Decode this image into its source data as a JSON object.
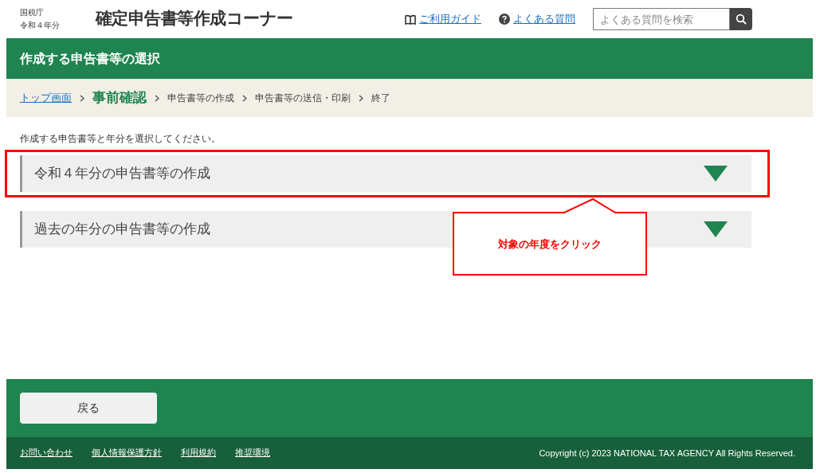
{
  "header": {
    "agency": "国税庁",
    "year": "令和４年分",
    "title": "確定申告書等作成コーナー",
    "links": [
      {
        "kind": "guide",
        "label": "ご利用ガイド"
      },
      {
        "kind": "faq",
        "label": "よくある質問"
      }
    ],
    "search": {
      "placeholder": "よくある質問を検索"
    }
  },
  "page_title": "作成する申告書等の選択",
  "breadcrumb": [
    {
      "label": "トップ画面",
      "kind": "link",
      "current": false
    },
    {
      "label": "事前確認",
      "kind": "step",
      "current": true
    },
    {
      "label": "申告書等の作成",
      "kind": "step",
      "current": false
    },
    {
      "label": "申告書等の送信・印刷",
      "kind": "step",
      "current": false
    },
    {
      "label": "終了",
      "kind": "step",
      "current": false
    }
  ],
  "instruction": "作成する申告書等と年分を選択してください。",
  "sections": [
    {
      "label": "令和４年分の申告書等の作成",
      "expanded": false,
      "highlighted": true
    },
    {
      "label": "過去の年分の申告書等の作成",
      "expanded": false,
      "highlighted": false
    }
  ],
  "callout": "対象の年度をクリック",
  "back_button": "戻る",
  "footer": {
    "links": [
      "お問い合わせ",
      "個人情報保護方針",
      "利用規約",
      "推奨環境"
    ],
    "copyright": "Copyright (c) 2023 NATIONAL TAX AGENCY All Rights Reserved."
  }
}
